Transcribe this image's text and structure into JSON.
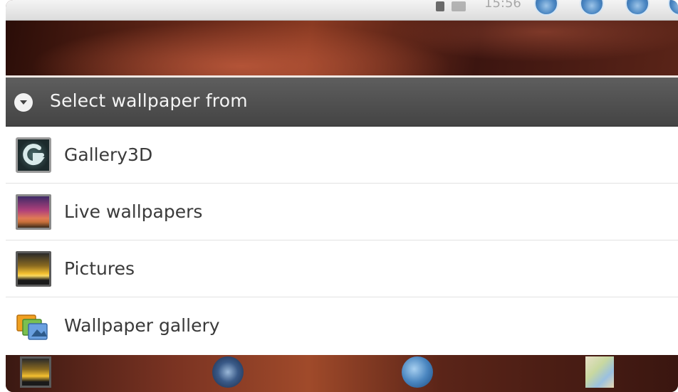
{
  "status_bar": {
    "time": "15:56",
    "icons": [
      "sd-card-icon",
      "usb-icon"
    ],
    "buttons": [
      "back-button",
      "menu-button",
      "home-button",
      "search-button"
    ]
  },
  "dialog": {
    "title": "Select wallpaper from",
    "title_icon": "chevron-down-circle-icon",
    "items": [
      {
        "label": "Gallery3D",
        "icon": "gallery3d-icon"
      },
      {
        "label": "Live wallpapers",
        "icon": "live-wallpapers-icon"
      },
      {
        "label": "Pictures",
        "icon": "pictures-icon"
      },
      {
        "label": "Wallpaper gallery",
        "icon": "wallpaper-gallery-icon"
      }
    ]
  },
  "dock": {
    "items": [
      "pictures-app-icon",
      "music-app-icon",
      "browser-app-icon",
      "maps-app-icon"
    ]
  },
  "colors": {
    "header_bg": "#4e4e4e",
    "header_text": "#f4f4f4",
    "list_bg": "#ffffff",
    "list_text": "#3a3a3a",
    "divider": "#e2e2e2"
  }
}
